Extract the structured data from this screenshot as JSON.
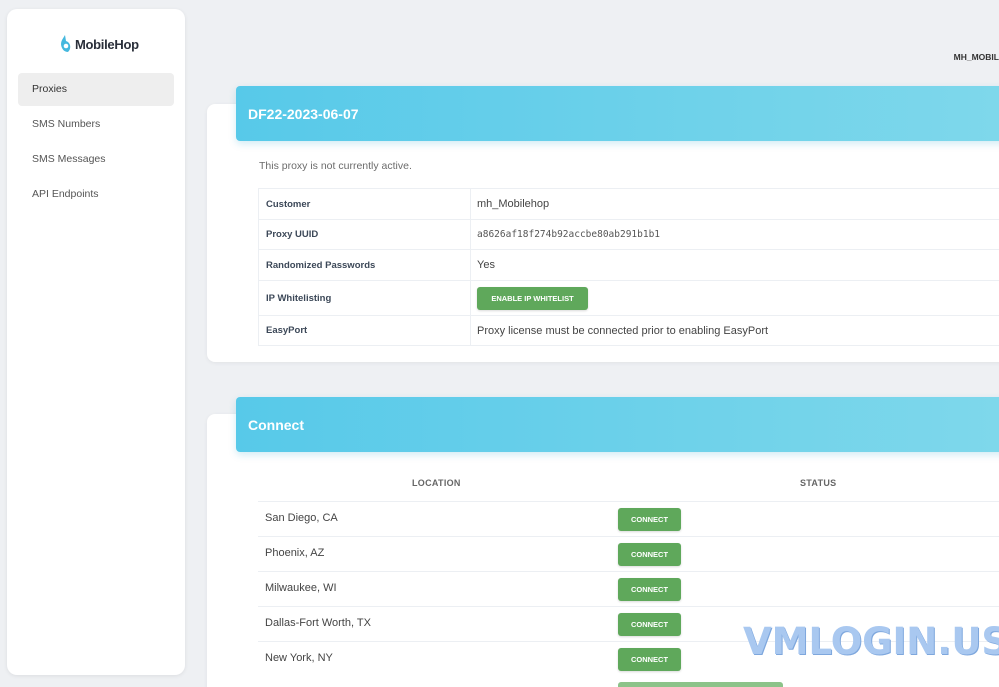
{
  "brand": {
    "name": "MobileHop"
  },
  "sidebar": {
    "items": [
      {
        "label": "Proxies",
        "active": true
      },
      {
        "label": "SMS Numbers",
        "active": false
      },
      {
        "label": "SMS Messages",
        "active": false
      },
      {
        "label": "API Endpoints",
        "active": false
      }
    ]
  },
  "header": {
    "username": "MH_MOBIL"
  },
  "proxy": {
    "title": "DF22-2023-06-07",
    "status_note": "This proxy is not currently active.",
    "details": [
      {
        "label": "Customer",
        "value": "mh_Mobilehop"
      },
      {
        "label": "Proxy UUID",
        "value": "a8626af18f274b92accbe80ab291b1b1"
      },
      {
        "label": "Randomized Passwords",
        "value": "Yes"
      },
      {
        "label": "IP Whitelisting",
        "button_label": "ENABLE IP WHITELIST"
      },
      {
        "label": "EasyPort",
        "value": "Proxy license must be connected prior to enabling EasyPort"
      }
    ]
  },
  "connect": {
    "title": "Connect",
    "columns": {
      "location": "LOCATION",
      "status": "STATUS"
    },
    "button_label": "CONNECT",
    "locations": [
      "San Diego, CA",
      "Phoenix, AZ",
      "Milwaukee, WI",
      "Dallas-Fort Worth, TX",
      "New York, NY"
    ]
  },
  "watermark": "VMLOGIN.US",
  "colors": {
    "accent": "#57c9e9",
    "button_green": "#5fa85b"
  }
}
